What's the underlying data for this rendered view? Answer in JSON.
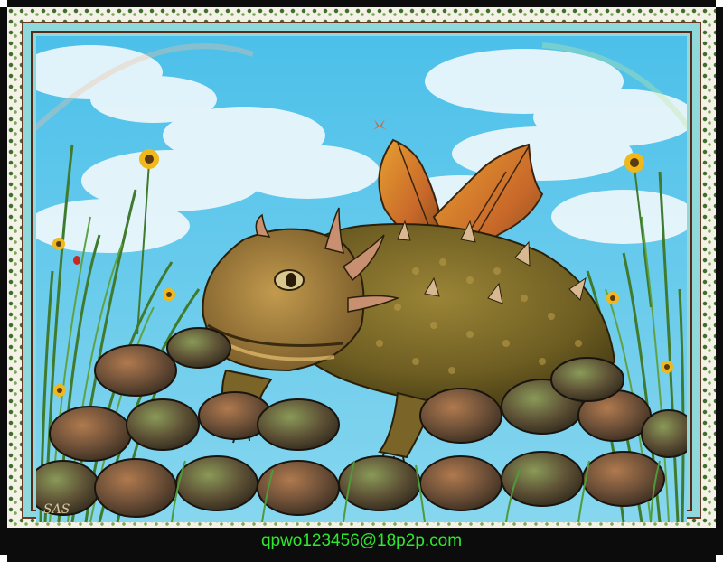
{
  "caption": {
    "text": "qpwo123456@18p2p.com"
  },
  "signature": {
    "text": "SAS"
  },
  "colors": {
    "sky": "#3fb8e4",
    "cloud": "#eaf6fb",
    "frame_black": "#0c0c0c",
    "mat_blue": "#8fd8dc",
    "caption_green": "#2ee82e",
    "lizard_body": "#7a6a2a",
    "wing_orange": "#d98a2a"
  },
  "icons": [
    "vine-border",
    "sunflower-icon",
    "butterfly-icon",
    "ladybug-icon"
  ]
}
